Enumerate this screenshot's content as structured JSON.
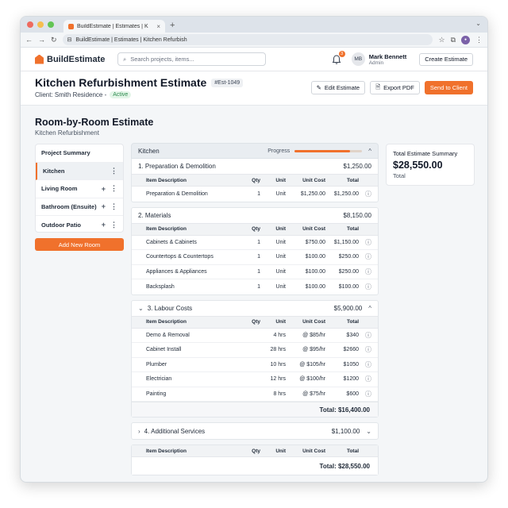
{
  "browser": {
    "tab_title": "BuildEstimate | Estimates | K",
    "tab_close": "×",
    "new_tab": "+",
    "url": "BuildEstimate | Estimates | Kitchen Refurbish"
  },
  "header": {
    "brand": "BuildEstimate",
    "search_placeholder": "Search projects, items...",
    "notification_count": "3",
    "user_initials": "MB",
    "user_name": "Mark Bennett",
    "user_role": "Admin",
    "create_label": "Create Estimate"
  },
  "estimate": {
    "title": "Kitchen Refurbishment Estimate",
    "id": "#Est-1049",
    "client": "Client: Smith Residence -",
    "status": "Active",
    "edit_label": "Edit Estimate",
    "export_label": "Export PDF",
    "send_label": "Send to Client"
  },
  "section": {
    "title": "Room-by-Room Estimate",
    "subtitle": "Kitchen Refurbishment"
  },
  "sidebar": {
    "header": "Project Summary",
    "rooms": [
      {
        "label": "Kitchen"
      },
      {
        "label": "Living Room"
      },
      {
        "label": "Bathroom (Ensuite)"
      },
      {
        "label": "Outdoor Patio"
      }
    ],
    "add_room_label": "Add New Room"
  },
  "main": {
    "room_title": "Kitchen",
    "progress_label": "Progress",
    "progress_fraction": 0.82,
    "columns": {
      "desc": "Item Description",
      "qty": "Qty",
      "unit": "Unit",
      "cost": "Unit Cost",
      "total": "Total"
    },
    "categories": [
      {
        "title": "1. Preparation & Demolition",
        "total": "$1,250.00",
        "rows": [
          {
            "desc": "Preparation & Demolition",
            "qty": "1",
            "unit": "Unit",
            "cost": "$1,250.00",
            "total": "$1,250.00"
          }
        ]
      },
      {
        "title": "2. Materials",
        "total": "$8,150.00",
        "rows": [
          {
            "desc": "Cabinets & Cabinets",
            "qty": "1",
            "unit": "Unit",
            "cost": "$750.00",
            "total": "$1,150.00"
          },
          {
            "desc": "Countertops & Countertops",
            "qty": "1",
            "unit": "Unit",
            "cost": "$100.00",
            "total": "$250.00"
          },
          {
            "desc": "Appliances & Appliances",
            "qty": "1",
            "unit": "Unit",
            "cost": "$100.00",
            "total": "$250.00"
          },
          {
            "desc": "Backsplash",
            "qty": "1",
            "unit": "Unit",
            "cost": "$100.00",
            "total": "$100.00"
          }
        ]
      },
      {
        "title": "3. Labour Costs",
        "total": "$5,900.00",
        "rows": [
          {
            "desc": "Demo & Removal",
            "qty": "4 hrs",
            "unit": "",
            "cost": "@ $85/hr",
            "total": "$340"
          },
          {
            "desc": "Cabinet Install",
            "qty": "28 hrs",
            "unit": "",
            "cost": "@ $95/hr",
            "total": "$2660"
          },
          {
            "desc": "Plumber",
            "qty": "10 hrs",
            "unit": "",
            "cost": "@ $105/hr",
            "total": "$1050"
          },
          {
            "desc": "Electrician",
            "qty": "12 hrs",
            "unit": "",
            "cost": "@ $100/hr",
            "total": "$1200"
          },
          {
            "desc": "Painting",
            "qty": "8 hrs",
            "unit": "",
            "cost": "@ $75/hr",
            "total": "$600"
          }
        ],
        "footer": "Total: $16,400.00"
      },
      {
        "title": "4. Additional Services",
        "total": "$1,100.00"
      }
    ],
    "grand_total": "Total: $28,550.00"
  },
  "summary": {
    "title": "Total Estimate Summary",
    "amount": "$28,550.00",
    "label": "Total"
  },
  "colors": {
    "accent": "#f0712c",
    "active": "#2e8b4f"
  }
}
